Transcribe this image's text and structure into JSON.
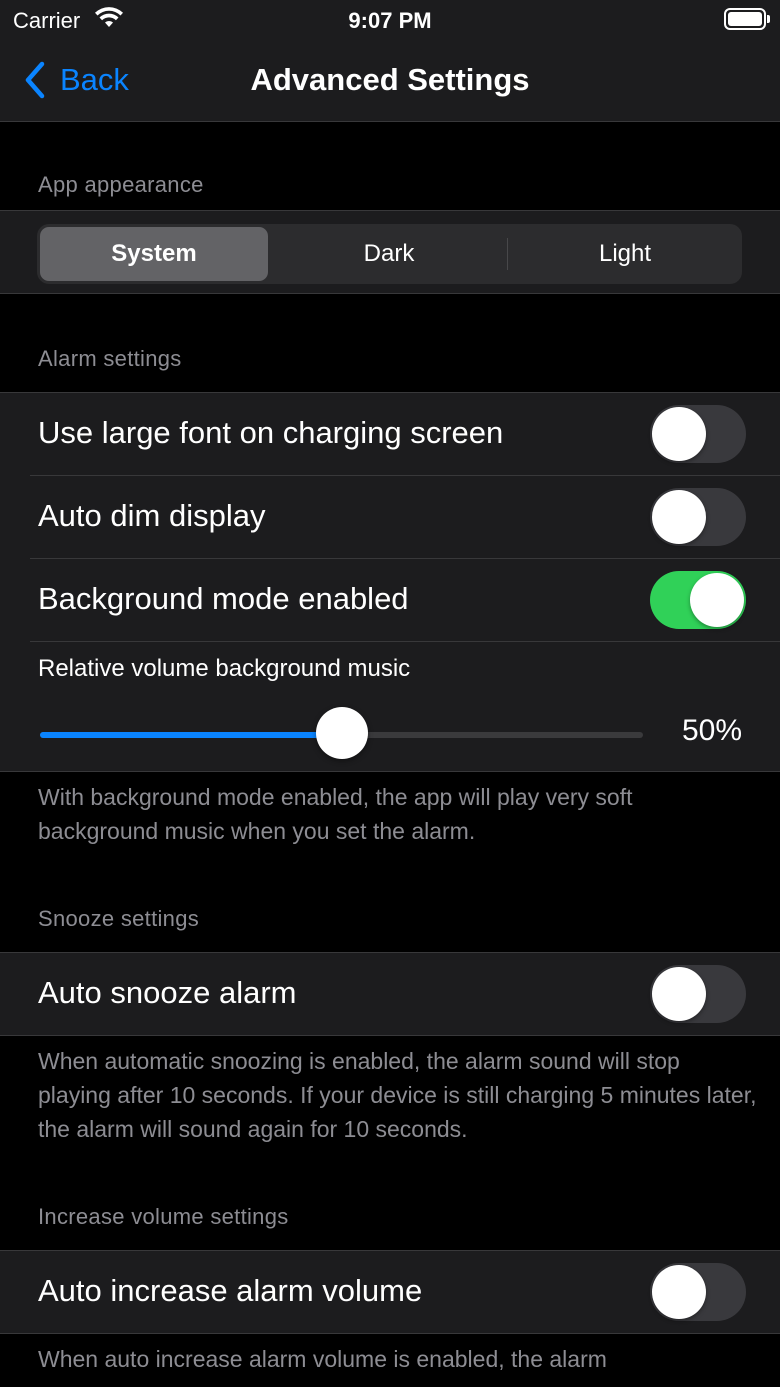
{
  "status_bar": {
    "carrier": "Carrier",
    "time": "9:07 PM"
  },
  "nav": {
    "back_label": "Back",
    "title": "Advanced Settings"
  },
  "appearance": {
    "header": "App appearance",
    "options": [
      "System",
      "Dark",
      "Light"
    ],
    "selected": "System"
  },
  "alarm": {
    "header": "Alarm settings",
    "large_font": {
      "label": "Use large font on charging screen",
      "on": false
    },
    "auto_dim": {
      "label": "Auto dim display",
      "on": false
    },
    "background_mode": {
      "label": "Background mode enabled",
      "on": true
    },
    "volume": {
      "label": "Relative volume background music",
      "value": 50,
      "value_text": "50%"
    },
    "footer": "With background mode enabled, the app will play very soft background music when you set the alarm."
  },
  "snooze": {
    "header": "Snooze settings",
    "auto_snooze": {
      "label": "Auto snooze alarm",
      "on": false
    },
    "footer": "When automatic snoozing is enabled, the alarm sound will stop playing after 10 seconds. If your device is still charging 5 minutes later, the alarm will sound again for 10 seconds."
  },
  "increase_volume": {
    "header": "Increase volume settings",
    "auto_increase": {
      "label": "Auto increase alarm volume",
      "on": false
    },
    "footer": "When auto increase alarm volume is enabled, the alarm"
  },
  "colors": {
    "accent": "#0a84ff",
    "toggle_on": "#30d158",
    "background": "#000000",
    "panel": "#1c1c1e"
  }
}
